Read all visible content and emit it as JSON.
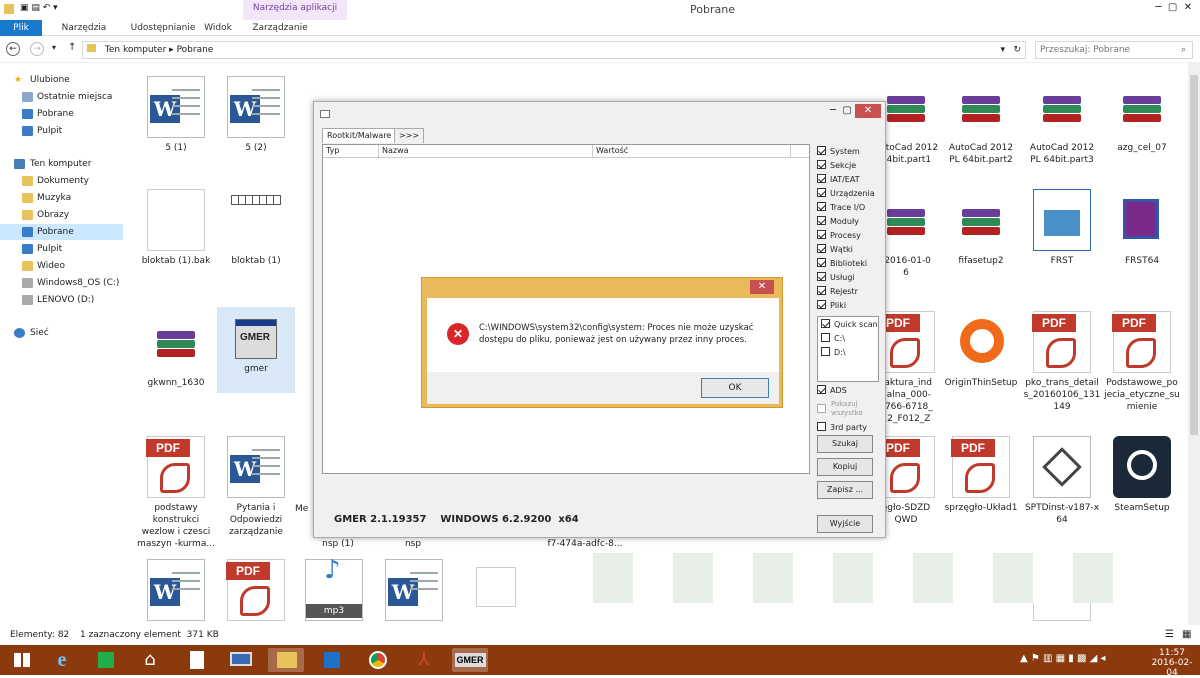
{
  "window": {
    "title": "Pobrane",
    "context_tab": "Narzędzia aplikacji"
  },
  "ribbon": {
    "tabs": [
      "Plik",
      "Narzędzia główne",
      "Udostępnianie",
      "Widok",
      "Zarządzanie"
    ]
  },
  "address": {
    "crumb1": "Ten komputer",
    "crumb2": "Pobrane",
    "search_placeholder": "Przeszukaj: Pobrane"
  },
  "sidebar": {
    "items": [
      "Ulubione",
      "Ostatnie miejsca",
      "Pobrane",
      "Pulpit",
      "Ten komputer",
      "Dokumenty",
      "Muzyka",
      "Obrazy",
      "Pobrane",
      "Pulpit",
      "Wideo",
      "Windows8_OS (C:)",
      "LENOVO (D:)",
      "Sieć"
    ]
  },
  "files": {
    "r1": [
      {
        "label": "5 (1)",
        "kind": "word"
      },
      {
        "label": "5 (2)",
        "kind": "word"
      },
      {
        "label": "AutoCad 2012\n64bit.part1",
        "kind": "rar"
      },
      {
        "label": "AutoCad 2012\nPL 64bit.part2",
        "kind": "rar"
      },
      {
        "label": "AutoCad 2012\nPL 64bit.part3",
        "kind": "rar"
      },
      {
        "label": "azg_cel_07",
        "kind": "rar"
      }
    ],
    "r2": [
      {
        "label": "bloktab (1).bak",
        "kind": "blank"
      },
      {
        "label": "bloktab (1)",
        "kind": "table"
      },
      {
        "label": "-2016-01-0\n6",
        "kind": "rar"
      },
      {
        "label": "fifasetup2",
        "kind": "rar"
      },
      {
        "label": "FRST",
        "kind": "doc"
      },
      {
        "label": "FRST64",
        "kind": "app"
      }
    ],
    "r3": [
      {
        "label": "gkwnn_1630",
        "kind": "rar"
      },
      {
        "label": "gmer",
        "kind": "gmer"
      },
      {
        "label": "Faktura_ind\nualna_000-\n7766-6718_\n12_F012_Z",
        "kind": "pdf"
      },
      {
        "label": "OriginThinSetup",
        "kind": "origin"
      },
      {
        "label": "pko_trans_detail\ns_20160106_131\n149",
        "kind": "pdf"
      },
      {
        "label": "Podstawowe_po\njecia_etyczne_su\nmienie",
        "kind": "pdf"
      }
    ],
    "r4": [
      {
        "label": "podstawy\nkonstrukci\nwezlow i czesci\nmaszyn -kurma...",
        "kind": "pdf"
      },
      {
        "label": "Pytania i\nOdpowiedzi\nzarządzanie",
        "kind": "word"
      },
      {
        "label": "ęgło-SDZD\nQWD",
        "kind": "pdf"
      },
      {
        "label": "sprzęgło-Układ1",
        "kind": "pdf"
      },
      {
        "label": "SPTDinst-v187-x\n64",
        "kind": "setup"
      },
      {
        "label": "SteamSetup",
        "kind": "steam"
      }
    ],
    "partials": [
      "Me",
      "nsp (1)",
      "nsp",
      "f7-474a-adfc-8..."
    ],
    "r5": [
      {
        "label": "",
        "kind": "word"
      },
      {
        "label": "",
        "kind": "pdf"
      },
      {
        "label": "MP3",
        "kind": "mp3"
      },
      {
        "label": "",
        "kind": "word"
      },
      {
        "label": "",
        "kind": "blank"
      }
    ]
  },
  "status": {
    "count": "Elementy: 82",
    "selected": "1 zaznaczony element  371 KB"
  },
  "gmer": {
    "tabs": [
      "Rootkit/Malware",
      ">>>"
    ],
    "columns": [
      "Typ",
      "Nazwa",
      "Wartość"
    ],
    "options": [
      {
        "label": "System",
        "checked": true
      },
      {
        "label": "Sekcje",
        "checked": true
      },
      {
        "label": "IAT/EAT",
        "checked": true
      },
      {
        "label": "Urządzenia",
        "checked": true
      },
      {
        "label": "Trace I/O",
        "checked": true
      },
      {
        "label": "Moduły",
        "checked": true
      },
      {
        "label": "Procesy",
        "checked": true
      },
      {
        "label": "Wątki",
        "checked": true
      },
      {
        "label": "Biblioteki",
        "checked": true
      },
      {
        "label": "Usługi",
        "checked": true
      },
      {
        "label": "Rejestr",
        "checked": true
      },
      {
        "label": "Pliki",
        "checked": true
      }
    ],
    "scan": [
      {
        "label": "Quick scan",
        "checked": true
      },
      {
        "label": "C:\\",
        "checked": false
      },
      {
        "label": "D:\\",
        "checked": false
      }
    ],
    "ads": {
      "label": "ADS",
      "checked": true
    },
    "show_all": "Pokazuj wszystko",
    "third": {
      "label": "3rd party",
      "checked": false
    },
    "buttons": [
      "Szukaj",
      "Kopiuj",
      "Zapisz ...",
      "Wyjście"
    ],
    "footer": "GMER 2.1.19357    WINDOWS 6.2.9200  x64"
  },
  "dialog": {
    "message": "C:\\WINDOWS\\system32\\config\\system: Proces nie może uzyskać dostępu do pliku, ponieważ jest on używany przez inny proces.",
    "ok": "OK",
    "close": "✕"
  },
  "taskbar": {
    "time": "11:57",
    "date": "2016-02-04",
    "active_label": "GMER"
  },
  "colors": {
    "taskbar": "#8b3a0e",
    "dialog_frame": "#e8ba5a",
    "word": "#2b5797",
    "pdf": "#c0392b"
  }
}
